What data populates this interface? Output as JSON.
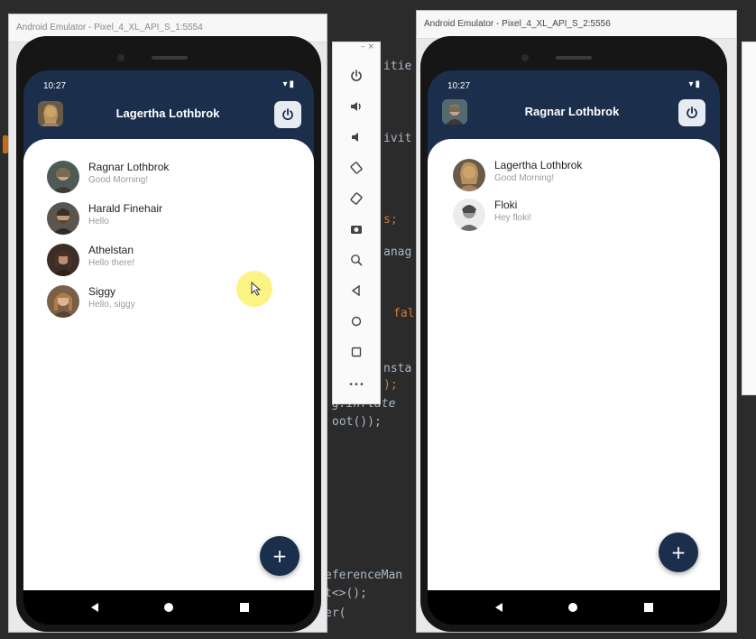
{
  "ide": {
    "code_fragments": [
      "itie",
      "ivit",
      "s;",
      "anag",
      "fal",
      "nsta",
      ");",
      "g.inflate",
      "oot());",
      "eferenceMan",
      "t<>();",
      "er("
    ]
  },
  "left_emulator": {
    "window_title": "Android Emulator - Pixel_4_XL_API_S_1:5554",
    "status_time": "10:27",
    "header_title": "Lagertha Lothbrok",
    "users": [
      {
        "name": "Ragnar Lothbrok",
        "message": "Good Morning!"
      },
      {
        "name": "Harald Finehair",
        "message": "Hello"
      },
      {
        "name": "Athelstan",
        "message": "Hello there!"
      },
      {
        "name": "Siggy",
        "message": "Hello, siggy"
      }
    ],
    "fab_label": "+"
  },
  "right_emulator": {
    "window_title": "Android Emulator - Pixel_4_XL_API_S_2:5556",
    "status_time": "10:27",
    "header_title": "Ragnar Lothbrok",
    "users": [
      {
        "name": "Lagertha Lothbrok",
        "message": "Good Morning!"
      },
      {
        "name": "Floki",
        "message": "Hey floki!"
      }
    ],
    "fab_label": "+"
  },
  "toolbar": {
    "header": "– ×",
    "more_label": "•••"
  },
  "colors": {
    "header_bg": "#1b2f4d",
    "sheet_bg": "#ffffff",
    "ide_bg": "#2b2b2b"
  }
}
